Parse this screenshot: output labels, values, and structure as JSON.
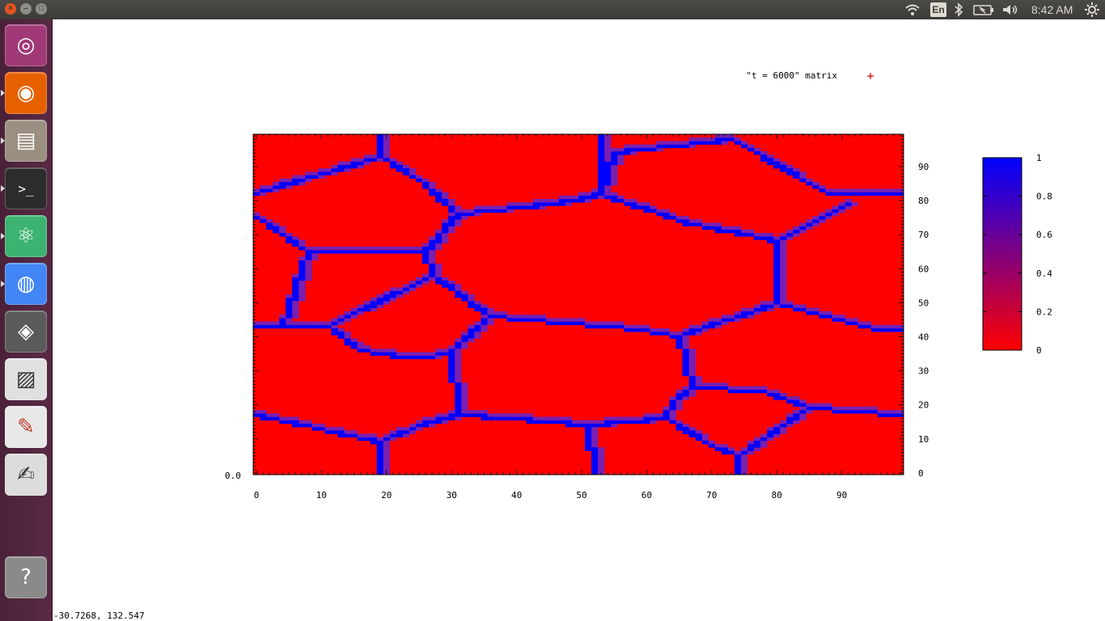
{
  "topbar": {
    "close_glyph": "×",
    "minimize_glyph": "–",
    "maximize_glyph": "□",
    "keyboard_layout": "En",
    "clock": "8:42 AM",
    "icons": [
      "wifi-icon",
      "keyboard-layout-indicator",
      "bluetooth-icon",
      "battery-icon",
      "volume-icon",
      "system-gear-icon"
    ]
  },
  "launcher": {
    "items": [
      {
        "name": "ubuntu-dash",
        "icon": "ubuntu-logo-icon",
        "color": "#a03a76"
      },
      {
        "name": "firefox",
        "icon": "firefox-icon",
        "color": "#e66000"
      },
      {
        "name": "files",
        "icon": "file-cabinet-icon",
        "color": "#9a8f80"
      },
      {
        "name": "terminal",
        "icon": "terminal-icon",
        "color": "#2c2c2c"
      },
      {
        "name": "atom",
        "icon": "atom-icon",
        "color": "#3cb371"
      },
      {
        "name": "chrome",
        "icon": "chrome-icon",
        "color": "#4285f4"
      },
      {
        "name": "virtualbox",
        "icon": "cube-icon",
        "color": "#5a5a5a"
      },
      {
        "name": "gnuplot-stripes",
        "icon": "stripes-icon",
        "color": "#e0e0e0"
      },
      {
        "name": "pdf-viewer",
        "icon": "pdf-icon",
        "color": "#e8e8e8"
      },
      {
        "name": "text-editor",
        "icon": "text-editor-icon",
        "color": "#dcdcdc"
      },
      {
        "name": "help",
        "icon": "question-icon",
        "color": "#8a8a8a"
      }
    ],
    "help_glyph": "?"
  },
  "status_text": "-30.7268,  132.547",
  "chart_data": {
    "type": "heatmap",
    "legend_label": "\"t = 6000\" matrix",
    "legend_marker": "+",
    "legend_position": "top-right",
    "x_ticks": [
      "0",
      "10",
      "20",
      "30",
      "40",
      "50",
      "60",
      "70",
      "80",
      "90"
    ],
    "y_ticks": [
      "0",
      "10",
      "20",
      "30",
      "40",
      "50",
      "60",
      "70",
      "80",
      "90"
    ],
    "y_axis_side": "right",
    "xlim": [
      0,
      99
    ],
    "ylim": [
      0,
      99
    ],
    "corner_label": "0.0",
    "colorbar": {
      "ticks": [
        "0",
        "0.2",
        "0.4",
        "0.6",
        "0.8",
        "1"
      ],
      "min_color": "#ff0000",
      "max_color": "#0000ff",
      "range": [
        0,
        1
      ]
    },
    "background_value": 0,
    "boundary_value": 1,
    "grain_boundaries": [
      [
        [
          0,
          82
        ],
        [
          19,
          93
        ],
        [
          25,
          86
        ],
        [
          31,
          76
        ],
        [
          41,
          78
        ],
        [
          49,
          80
        ],
        [
          53,
          82
        ]
      ],
      [
        [
          19,
          93
        ],
        [
          19,
          99
        ]
      ],
      [
        [
          53,
          82
        ],
        [
          55,
          94
        ],
        [
          73,
          98
        ],
        [
          88,
          82
        ],
        [
          99,
          82
        ]
      ],
      [
        [
          53,
          99
        ],
        [
          53,
          82
        ]
      ],
      [
        [
          53,
          82
        ],
        [
          65,
          74
        ],
        [
          80,
          68
        ],
        [
          91,
          79
        ]
      ],
      [
        [
          0,
          75
        ],
        [
          8,
          65
        ],
        [
          26,
          65
        ],
        [
          31,
          76
        ]
      ],
      [
        [
          80,
          68
        ],
        [
          80,
          50
        ]
      ],
      [
        [
          8,
          65
        ],
        [
          4,
          43
        ],
        [
          0,
          43
        ]
      ],
      [
        [
          26,
          65
        ],
        [
          27,
          58
        ],
        [
          36,
          46
        ],
        [
          30,
          36
        ],
        [
          27,
          34
        ],
        [
          23,
          34
        ],
        [
          19,
          35
        ]
      ],
      [
        [
          4,
          43
        ],
        [
          11,
          43
        ],
        [
          27,
          58
        ]
      ],
      [
        [
          11,
          43
        ],
        [
          16,
          36
        ],
        [
          19,
          35
        ]
      ],
      [
        [
          36,
          46
        ],
        [
          59,
          42
        ],
        [
          65,
          40
        ],
        [
          80,
          50
        ],
        [
          95,
          42
        ],
        [
          99,
          42
        ]
      ],
      [
        [
          30,
          36
        ],
        [
          31,
          17
        ],
        [
          39,
          16
        ],
        [
          51,
          14
        ],
        [
          63,
          16
        ],
        [
          64,
          21
        ],
        [
          67,
          25
        ],
        [
          65,
          40
        ]
      ],
      [
        [
          31,
          17
        ],
        [
          25,
          14
        ],
        [
          19,
          9
        ],
        [
          0,
          17
        ]
      ],
      [
        [
          19,
          9
        ],
        [
          19,
          0
        ]
      ],
      [
        [
          51,
          14
        ],
        [
          52,
          0
        ]
      ],
      [
        [
          67,
          25
        ],
        [
          78,
          24
        ],
        [
          85,
          19
        ],
        [
          99,
          17
        ]
      ],
      [
        [
          63,
          16
        ],
        [
          70,
          8
        ],
        [
          74,
          5
        ],
        [
          85,
          19
        ]
      ],
      [
        [
          74,
          5
        ],
        [
          74,
          0
        ]
      ]
    ],
    "colors": {
      "low": "#ff0000",
      "high": "#0000ff",
      "frame": "#000000",
      "legend_marker": "#cc0000"
    }
  }
}
